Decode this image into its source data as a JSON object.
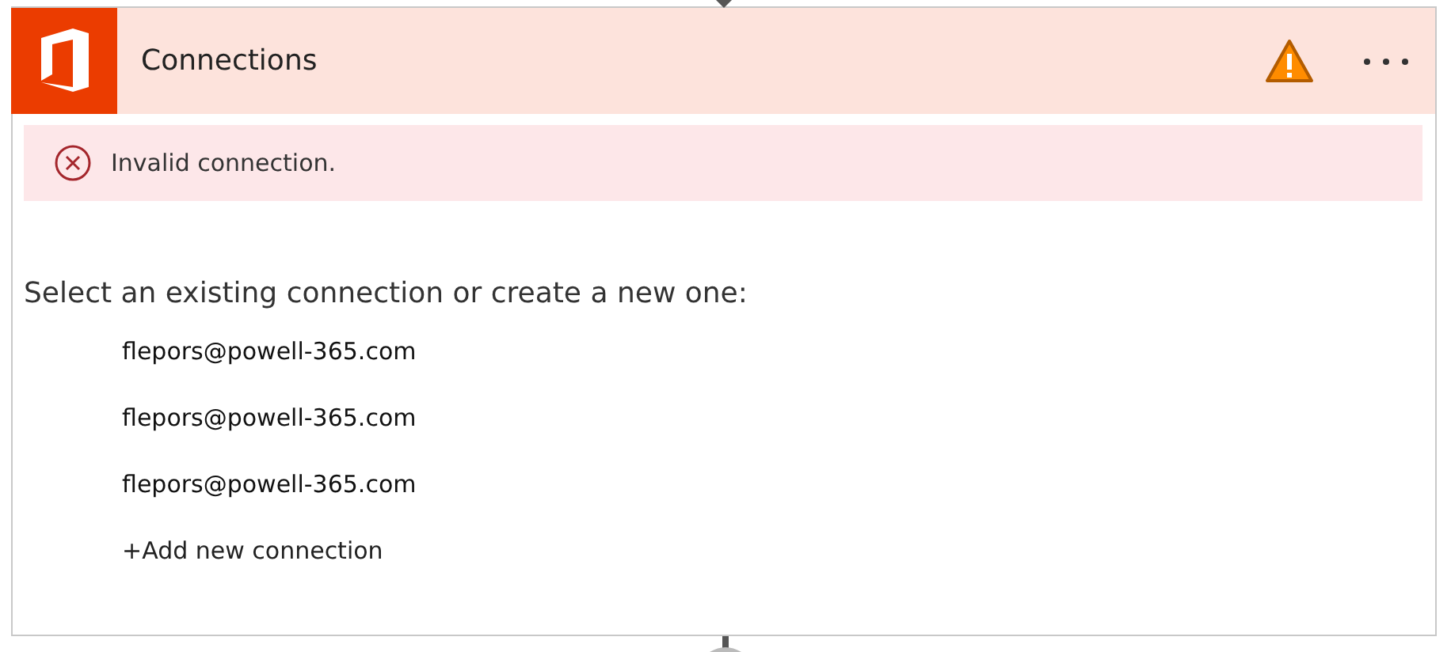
{
  "card": {
    "title": "Connections",
    "warning": true
  },
  "error": {
    "message": "Invalid connection."
  },
  "prompt": "Select an existing connection or create a new one:",
  "connections": [
    {
      "label": "flepors@powell-365.com",
      "kind": "account"
    },
    {
      "label": "flepors@powell-365.com",
      "kind": "account"
    },
    {
      "label": "flepors@powell-365.com",
      "kind": "account"
    },
    {
      "label": "+Add new connection",
      "kind": "add"
    }
  ]
}
